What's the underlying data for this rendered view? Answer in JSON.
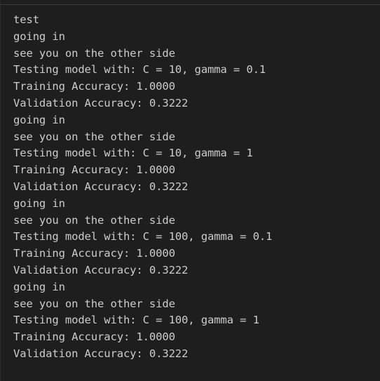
{
  "terminal": {
    "lines": [
      "test",
      "going in",
      "see you on the other side",
      "Testing model with: C = 10, gamma = 0.1",
      "Training Accuracy: 1.0000",
      "Validation Accuracy: 0.3222",
      "going in",
      "see you on the other side",
      "Testing model with: C = 10, gamma = 1",
      "Training Accuracy: 1.0000",
      "Validation Accuracy: 0.3222",
      "going in",
      "see you on the other side",
      "Testing model with: C = 100, gamma = 0.1",
      "Training Accuracy: 1.0000",
      "Validation Accuracy: 0.3222",
      "going in",
      "see you on the other side",
      "Testing model with: C = 100, gamma = 1",
      "Training Accuracy: 1.0000",
      "Validation Accuracy: 0.3222"
    ]
  },
  "colors": {
    "background": "#1e1e1e",
    "text": "#cccccc",
    "border": "#3c3c3c"
  }
}
